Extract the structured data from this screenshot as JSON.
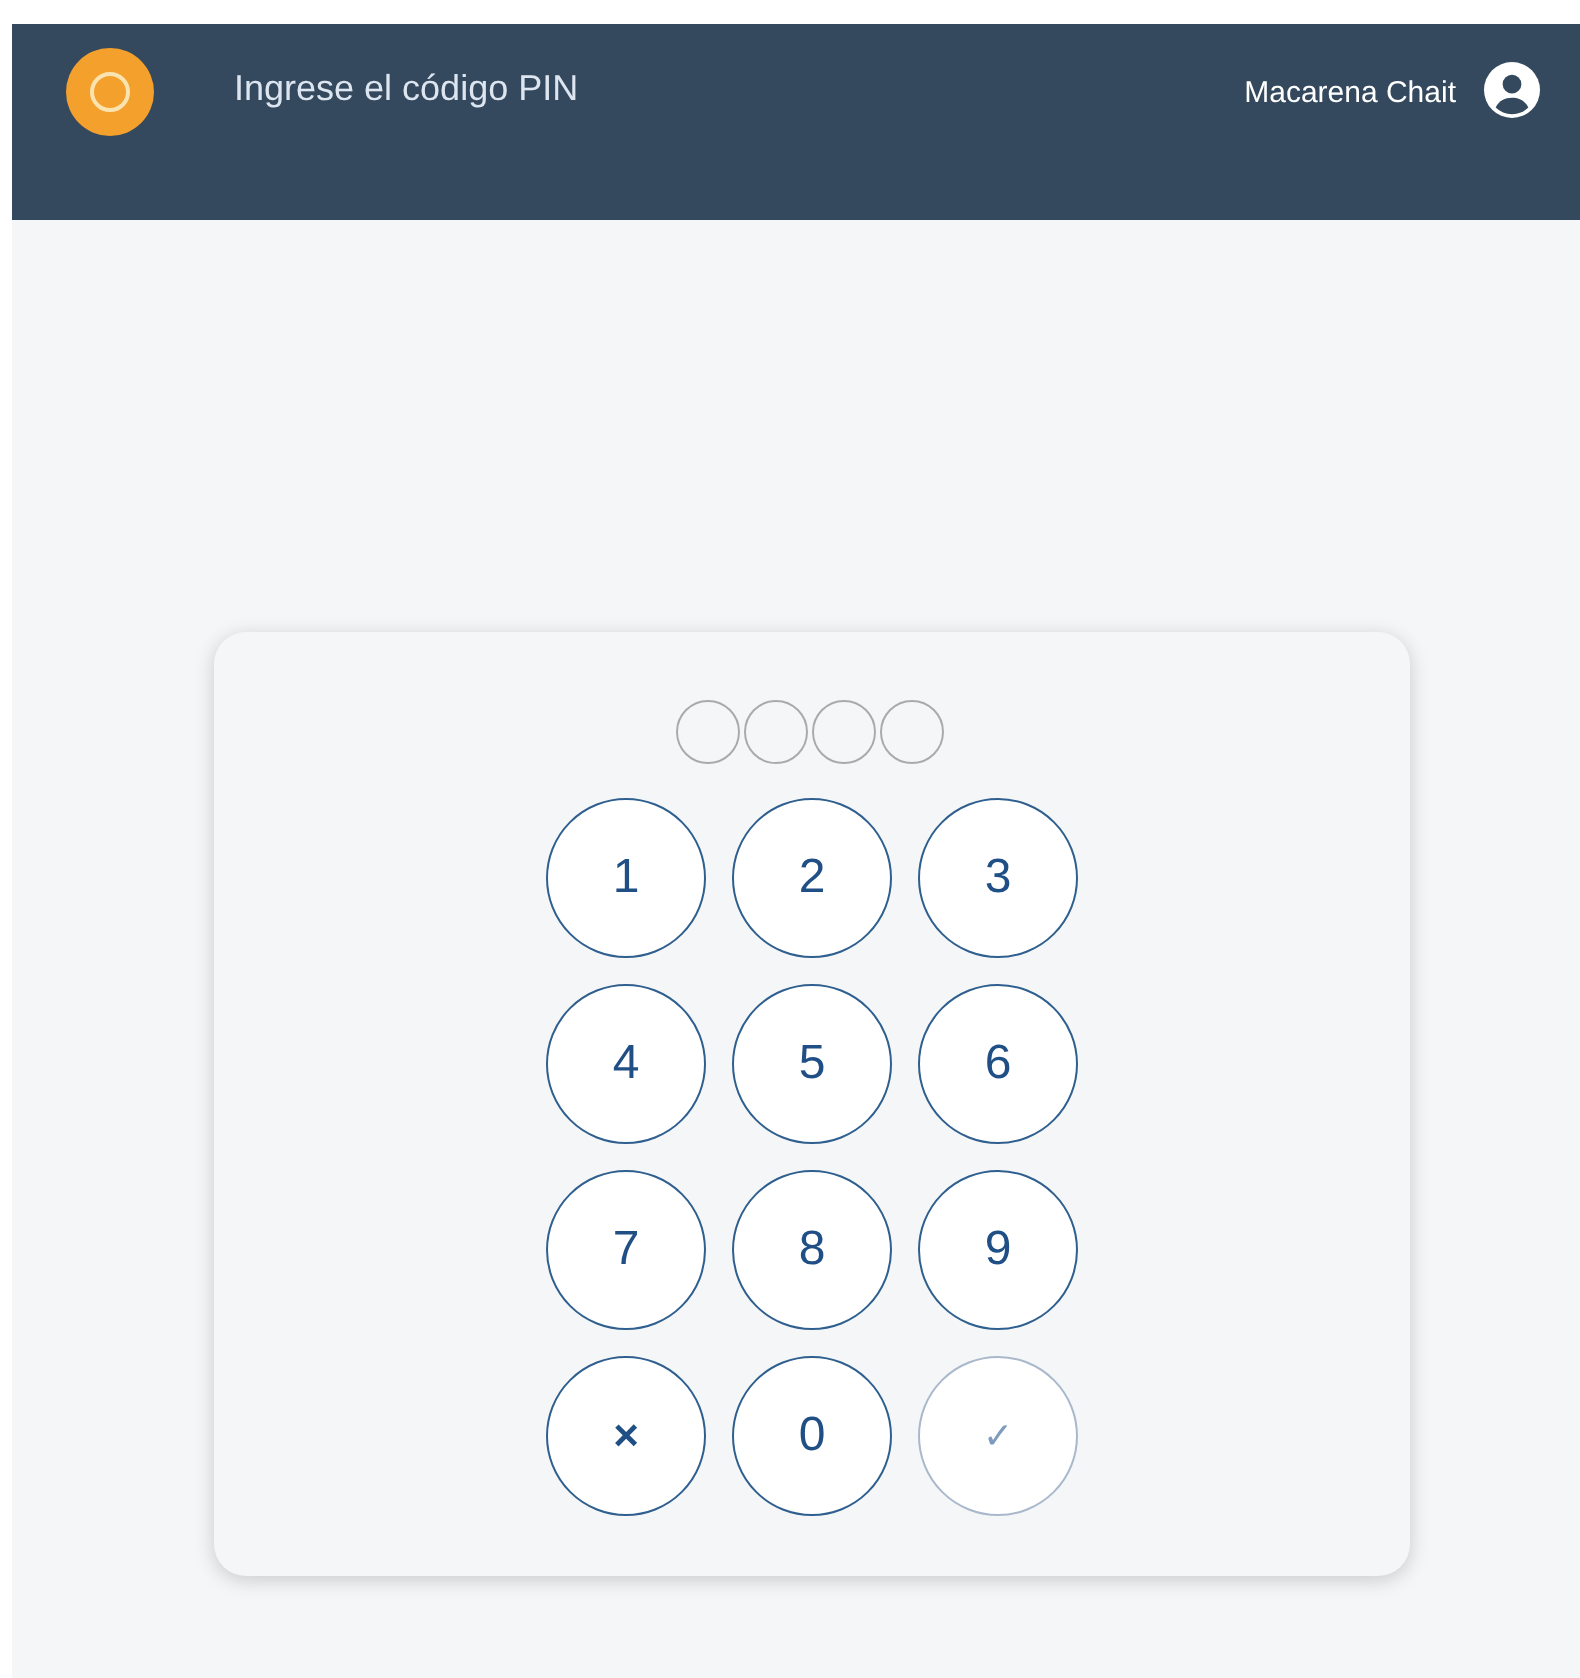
{
  "header": {
    "title": "Ingrese el código PIN",
    "user": "Macarena Chait"
  },
  "pin_dots": [
    {
      "filled": false
    },
    {
      "filled": false
    },
    {
      "filled": false
    },
    {
      "filled": false
    }
  ],
  "keys": [
    {
      "label": "1",
      "kind": "digit",
      "disabled": false
    },
    {
      "label": "2",
      "kind": "digit",
      "disabled": false
    },
    {
      "label": "3",
      "kind": "digit",
      "disabled": false
    },
    {
      "label": "4",
      "kind": "digit",
      "disabled": false
    },
    {
      "label": "5",
      "kind": "digit",
      "disabled": false
    },
    {
      "label": "6",
      "kind": "digit",
      "disabled": false
    },
    {
      "label": "7",
      "kind": "digit",
      "disabled": false
    },
    {
      "label": "8",
      "kind": "digit",
      "disabled": false
    },
    {
      "label": "9",
      "kind": "digit",
      "disabled": false
    },
    {
      "label": "×",
      "kind": "clear",
      "disabled": false
    },
    {
      "label": "0",
      "kind": "digit",
      "disabled": false
    },
    {
      "label": "✓",
      "kind": "confirm",
      "disabled": true
    }
  ]
}
